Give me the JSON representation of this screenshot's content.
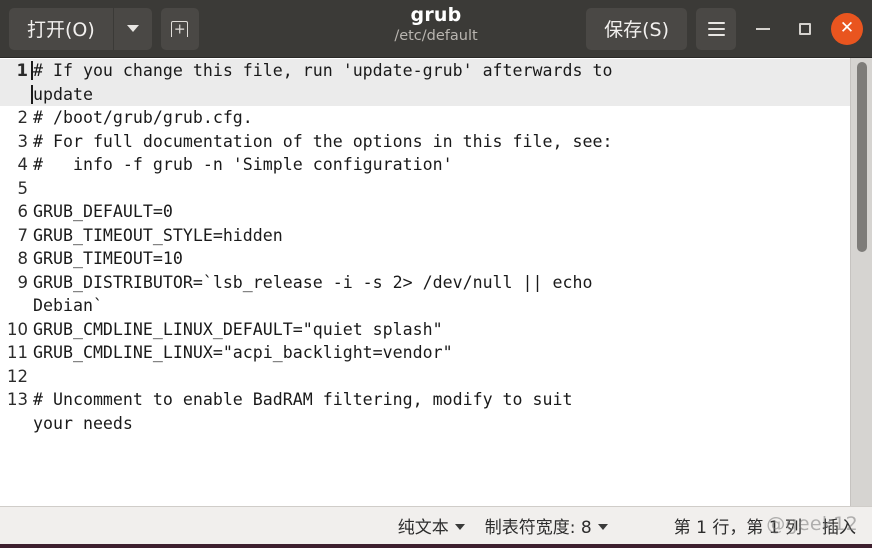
{
  "titlebar": {
    "open_label": "打开(O)",
    "open_dropdown_name": "open-dropdown",
    "new_document_label": "",
    "title": "grub",
    "subtitle": "/etc/default",
    "save_label": "保存(S)",
    "menu_label": "",
    "minimize_label": "",
    "maximize_label": "",
    "close_label": "✕",
    "colors": {
      "background": "#3b3a37",
      "button": "#4a4845",
      "close_button": "#e9551f",
      "title_text": "#ffffff",
      "subtitle_text": "#b9b5b0"
    }
  },
  "editor": {
    "current_line": 1,
    "lines": [
      {
        "number": "1",
        "text": "# If you change this file, run 'update-grub' afterwards to",
        "current": true
      },
      {
        "number": "",
        "text": "update",
        "current": true,
        "continuation": true
      },
      {
        "number": "2",
        "text": "# /boot/grub/grub.cfg."
      },
      {
        "number": "3",
        "text": "# For full documentation of the options in this file, see:"
      },
      {
        "number": "4",
        "text": "#   info -f grub -n 'Simple configuration'"
      },
      {
        "number": "5",
        "text": ""
      },
      {
        "number": "6",
        "text": "GRUB_DEFAULT=0"
      },
      {
        "number": "7",
        "text": "GRUB_TIMEOUT_STYLE=hidden"
      },
      {
        "number": "8",
        "text": "GRUB_TIMEOUT=10"
      },
      {
        "number": "9",
        "text": "GRUB_DISTRIBUTOR=`lsb_release -i -s 2> /dev/null || echo"
      },
      {
        "number": "",
        "text": "Debian`",
        "continuation": true
      },
      {
        "number": "10",
        "text": "GRUB_CMDLINE_LINUX_DEFAULT=\"quiet splash\""
      },
      {
        "number": "11",
        "text": "GRUB_CMDLINE_LINUX=\"acpi_backlight=vendor\""
      },
      {
        "number": "12",
        "text": ""
      },
      {
        "number": "13",
        "text": "# Uncomment to enable BadRAM filtering, modify to suit"
      },
      {
        "number": "",
        "text": "your needs",
        "continuation": true
      }
    ],
    "scroll_position_percent": 0
  },
  "statusbar": {
    "file_type": "纯文本",
    "tab_width_label": "制表符宽度: 8",
    "cursor_position": "第 1 行，第 1 列",
    "input_mode": "插入",
    "watermark": "@geek12"
  }
}
